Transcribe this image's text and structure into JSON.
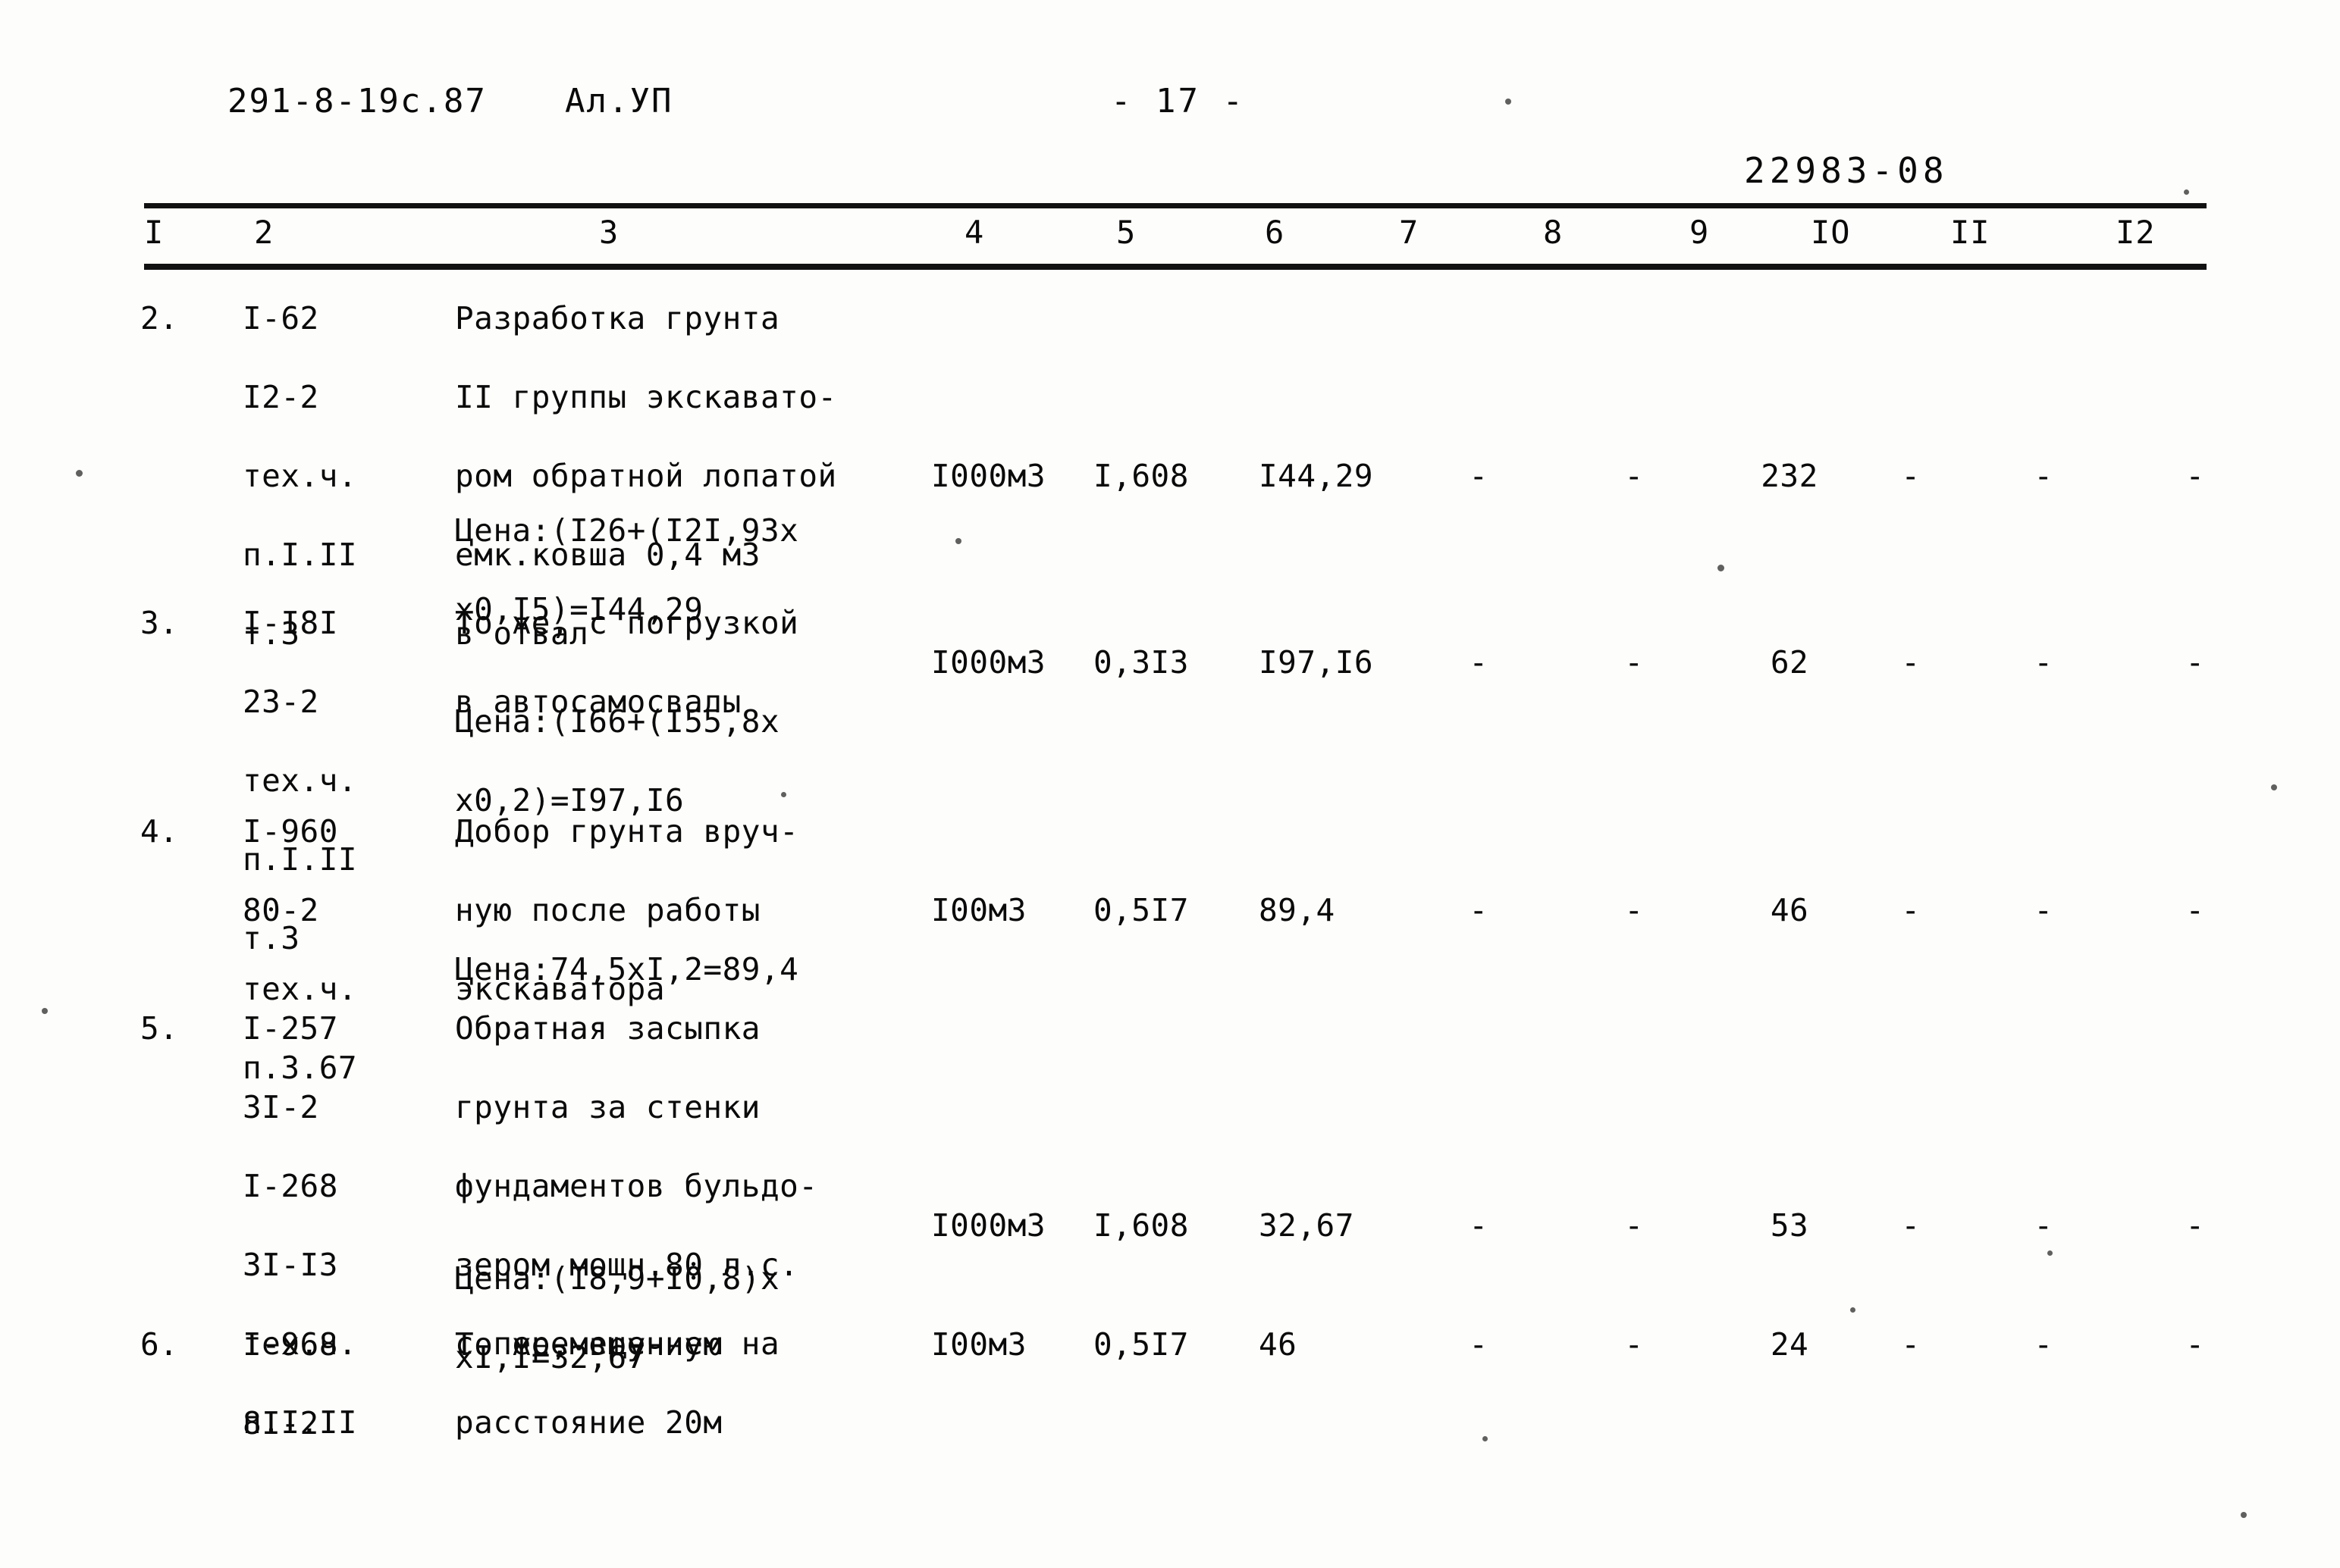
{
  "header": {
    "doc_code": "291-8-19с.87",
    "album": "Ал.УП",
    "page_label": "- 17 -",
    "stamp_number": "22983-08"
  },
  "table": {
    "column_numbers": [
      "I",
      "2",
      "3",
      "4",
      "5",
      "6",
      "7",
      "8",
      "9",
      "IO",
      "II",
      "I2"
    ],
    "rows": [
      {
        "no": "2.",
        "codes": [
          "I-62",
          "I2-2",
          "тех.ч.",
          "п.I.II",
          "т.3"
        ],
        "description": [
          "Разработка грунта",
          "II группы экскавато-",
          "ром обратной лопатой",
          "емк.ковша 0,4 м3",
          "в отвал"
        ],
        "note": [
          "Цена:(I26+(I2I,93х",
          "х0,I5)=I44,29"
        ],
        "unit": "I000м3",
        "qty": "I,608",
        "price": "I44,29",
        "col7": "-",
        "col8": "-",
        "col9": "232",
        "col10": "-",
        "col11": "-",
        "col12": "-"
      },
      {
        "no": "3.",
        "codes": [
          "I-I8I",
          "23-2",
          "тех.ч.",
          "п.I.II",
          "т.3"
        ],
        "description": [
          "То же, с погрузкой",
          "в автосамосвалы"
        ],
        "note": [
          "Цена:(I66+(I55,8х",
          "х0,2)=I97,I6"
        ],
        "unit": "I000м3",
        "qty": "0,3I3",
        "price": "I97,I6",
        "col7": "-",
        "col8": "-",
        "col9": "62",
        "col10": "-",
        "col11": "-",
        "col12": "-"
      },
      {
        "no": "4.",
        "codes": [
          "I-960",
          "80-2",
          "тех.ч.",
          "п.3.67"
        ],
        "description": [
          "Добор грунта вруч-",
          "ную после работы",
          "экскаватора"
        ],
        "note": [
          "Цена:74,5хI,2=89,4"
        ],
        "unit": "I00м3",
        "qty": "0,5I7",
        "price": "89,4",
        "col7": "-",
        "col8": "-",
        "col9": "46",
        "col10": "-",
        "col11": "-",
        "col12": "-"
      },
      {
        "no": "5.",
        "codes": [
          "I-257",
          "3I-2",
          "I-268",
          "3I-I3",
          "тех.ч.",
          "п.I.II"
        ],
        "description": [
          "Обратная засыпка",
          "грунта за стенки",
          "фундаментов бульдо-",
          "зером мощн.80 л.с.",
          "с перемещением на",
          "расстояние 20м"
        ],
        "note": [
          "Цена:(I8,9+I0,8)х",
          "хI,I=32,67"
        ],
        "unit": "I000м3",
        "qty": "I,608",
        "price": "32,67",
        "col7": "-",
        "col8": "-",
        "col9": "53",
        "col10": "-",
        "col11": "-",
        "col12": "-"
      },
      {
        "no": "6.",
        "codes": [
          "I-968",
          "8I-2"
        ],
        "description": [
          "То же, вручную"
        ],
        "note": [],
        "unit": "I00м3",
        "qty": "0,5I7",
        "price": "46",
        "col7": "-",
        "col8": "-",
        "col9": "24",
        "col10": "-",
        "col11": "-",
        "col12": "-"
      }
    ]
  }
}
